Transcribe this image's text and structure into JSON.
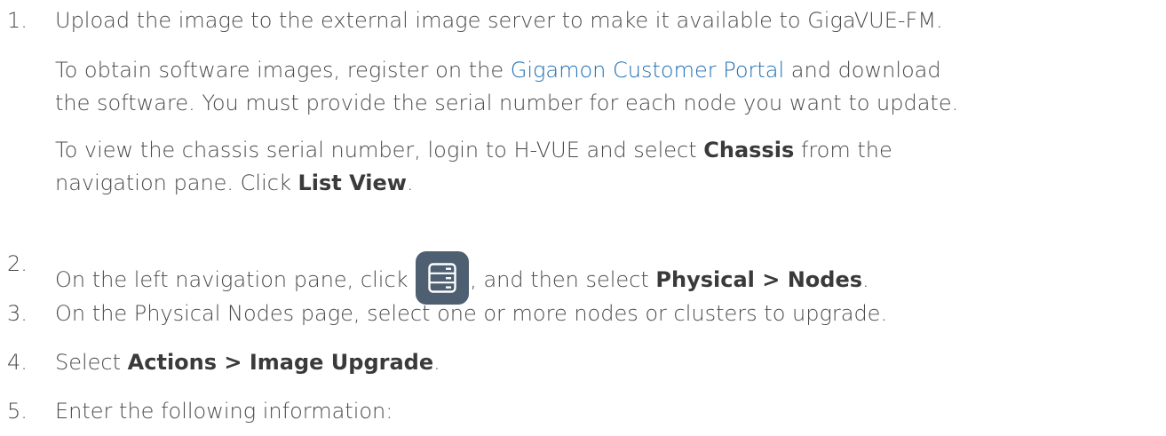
{
  "steps": [
    {
      "number": "1.",
      "text": "Upload the image to the external image server to make it available to GigaVUE-FM.",
      "notes": [
        {
          "pre": "To obtain software images, register on the ",
          "link": "Gigamon Customer Portal",
          "post": " and download",
          "line2": "the software. You must provide the serial number for each node you want to update."
        },
        {
          "pre": "To view the chassis serial number, login to H-VUE and select ",
          "bold1": "Chassis",
          "mid": " from the",
          "line2_pre": "navigation pane. Click ",
          "bold2": "List View",
          "line2_post": "."
        }
      ]
    },
    {
      "number": "2.",
      "pre": "On the left navigation pane, click ",
      "icon": "server-icon",
      "post": ", and then select ",
      "bold": "Physical > Nodes",
      "end": "."
    },
    {
      "number": "3.",
      "text": "On the Physical Nodes page, select one or more nodes or clusters to upgrade."
    },
    {
      "number": "4.",
      "pre": "Select ",
      "bold": "Actions > Image Upgrade",
      "end": "."
    },
    {
      "number": "5.",
      "text": "Enter the following information:"
    }
  ],
  "colors": {
    "text": "#4a4a4a",
    "link": "#1f6fb2",
    "icon_bg": "#4d5f70"
  }
}
